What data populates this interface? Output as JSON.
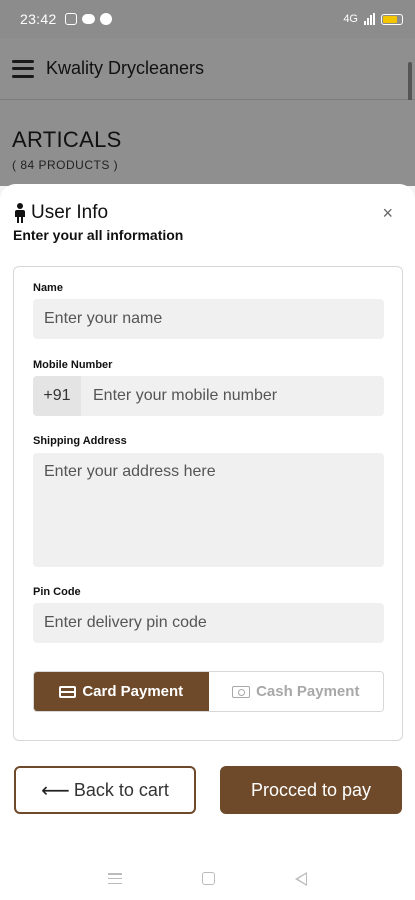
{
  "status_bar": {
    "time": "23:42",
    "network": "4G"
  },
  "app": {
    "title": "Kwality Drycleaners"
  },
  "page": {
    "heading": "ARTICALS",
    "product_count": "( 84 PRODUCTS )"
  },
  "sheet": {
    "title": "User Info",
    "subtitle": "Enter your all information",
    "close_label": "×",
    "fields": {
      "name": {
        "label": "Name",
        "placeholder": "Enter your name",
        "value": ""
      },
      "mobile": {
        "label": "Mobile Number",
        "prefix": "+91",
        "placeholder": "Enter your mobile number",
        "value": ""
      },
      "address": {
        "label": "Shipping Address",
        "placeholder": "Enter your address here",
        "value": ""
      },
      "pincode": {
        "label": "Pin Code",
        "placeholder": "Enter delivery pin code",
        "value": ""
      }
    },
    "payment": {
      "selected": "card",
      "card_label": "Card Payment",
      "cash_label": "Cash Payment"
    },
    "actions": {
      "back_label": "Back to cart",
      "pay_label": "Procced to pay"
    }
  },
  "colors": {
    "accent": "#6e4a2a",
    "overlay": "#8f8f8f",
    "input_bg": "#f0f0f0"
  },
  "icons": [
    "instagram-icon",
    "cloud-icon",
    "bluetooth-icon",
    "wifi-icon",
    "signal-icon",
    "battery-icon",
    "menu-icon",
    "person-icon",
    "close-icon",
    "card-icon",
    "cash-icon",
    "arrow-left-icon",
    "nav-menu-icon",
    "nav-home-icon",
    "nav-back-icon"
  ]
}
